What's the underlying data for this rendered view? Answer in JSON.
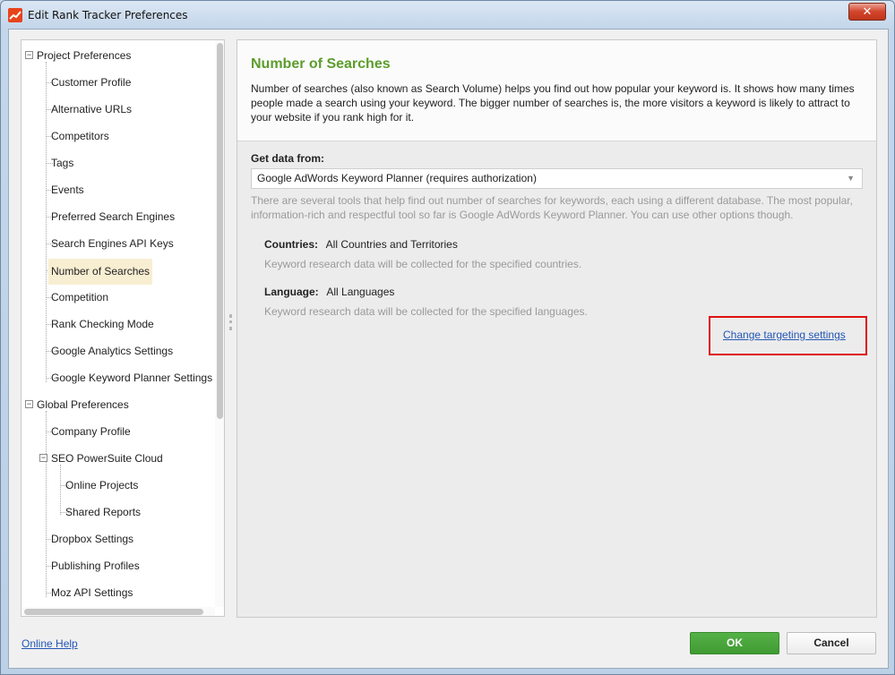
{
  "window": {
    "title": "Edit Rank Tracker Preferences",
    "close_label": "✕"
  },
  "tree": {
    "project_group": "Project Preferences",
    "project_items": [
      "Customer Profile",
      "Alternative URLs",
      "Competitors",
      "Tags",
      "Events",
      "Preferred Search Engines",
      "Search Engines API Keys",
      "Number of Searches",
      "Competition",
      "Rank Checking Mode",
      "Google Analytics Settings",
      "Google Keyword Planner Settings"
    ],
    "selected": "Number of Searches",
    "global_group": "Global Preferences",
    "global_items": {
      "company_profile": "Company Profile",
      "cloud": "SEO PowerSuite Cloud",
      "online_projects": "Online Projects",
      "shared_reports": "Shared Reports",
      "dropbox": "Dropbox Settings",
      "publishing": "Publishing Profiles",
      "moz": "Moz API Settings"
    },
    "expander_symbol": "−"
  },
  "content": {
    "title": "Number of Searches",
    "description": "Number of searches (also known as Search Volume) helps you find out how popular your keyword is. It shows how many times people made a search using your keyword. The bigger number of searches is, the more visitors a keyword is likely to attract to your website if you rank high for it.",
    "get_data_label": "Get data from:",
    "source_value": "Google AdWords Keyword Planner (requires authorization)",
    "source_hint": "There are several tools that help find out number of searches for keywords, each using a different database. The most popular, information-rich and respectful tool so far is Google AdWords Keyword Planner. You can use other options though.",
    "countries_label": "Countries:",
    "countries_value": "All Countries and Territories",
    "countries_hint": "Keyword research data will be collected for the specified countries.",
    "language_label": "Language:",
    "language_value": "All Languages",
    "language_hint": "Keyword research data will be collected for the specified languages.",
    "change_targeting_link": "Change targeting settings"
  },
  "footer": {
    "online_help": "Online Help",
    "ok": "OK",
    "cancel": "Cancel"
  },
  "colors": {
    "accent_green": "#5c9d2c",
    "ok_button": "#3f9a32",
    "link": "#2357b6",
    "highlight_box": "#e01010",
    "selected_item": "#f8eed2"
  },
  "icons": {
    "app": "rank-tracker-chart-icon",
    "close": "close-icon",
    "dropdown": "chevron-down-icon"
  }
}
